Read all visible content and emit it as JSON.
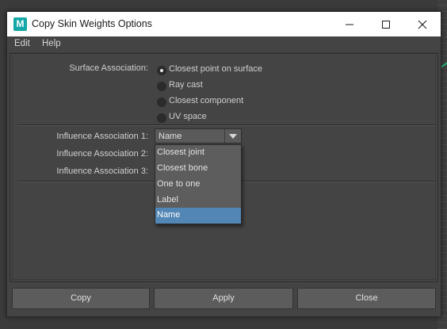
{
  "window": {
    "title": "Copy Skin Weights Options",
    "app_icon_letter": "M",
    "app_icon_color": "#13a7a7"
  },
  "menu": {
    "items": [
      "Edit",
      "Help"
    ]
  },
  "surface_association": {
    "label": "Surface Association:",
    "options": [
      {
        "label": "Closest point on surface",
        "selected": true
      },
      {
        "label": "Ray cast",
        "selected": false
      },
      {
        "label": "Closest component",
        "selected": false
      },
      {
        "label": "UV space",
        "selected": false
      }
    ]
  },
  "influence": {
    "label_1": "Influence Association 1:",
    "label_2": "Influence Association 2:",
    "label_3": "Influence Association 3:",
    "combo_1_value": "Name",
    "dropdown_options": [
      {
        "label": "Closest joint",
        "selected": false
      },
      {
        "label": "Closest bone",
        "selected": false
      },
      {
        "label": "One to one",
        "selected": false
      },
      {
        "label": "Label",
        "selected": false
      },
      {
        "label": "Name",
        "selected": true
      }
    ]
  },
  "buttons": {
    "copy": "Copy",
    "apply": "Apply",
    "close": "Close"
  },
  "colors": {
    "selection_highlight": "#5286b4",
    "dialog_background": "#444444"
  }
}
